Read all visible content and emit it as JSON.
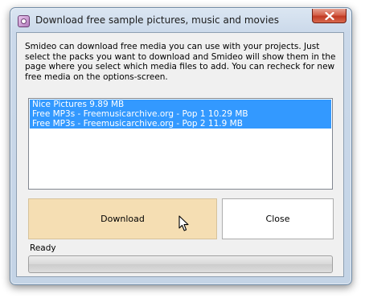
{
  "window": {
    "title": "Download free sample pictures, music and movies",
    "close_icon": "close-icon",
    "app_icon": "smideo-app-icon"
  },
  "description": "Smideo can download free media you can use with your projects. Just select the packs you want to download and Smideo will show them in the page where you select which media files to add. You can recheck for new free media on the options-screen.",
  "packs": [
    "Nice Pictures  9.89 MB",
    "Free MP3s - Freemusicarchive.org - Pop 1  10.29 MB",
    "Free MP3s - Freemusicarchive.org - Pop 2  11.9 MB"
  ],
  "buttons": {
    "download_label": "Download",
    "close_label": "Close"
  },
  "status": "Ready",
  "progress": 0,
  "colors": {
    "selection": "#3399ff",
    "download_button": "#f5deb3"
  }
}
